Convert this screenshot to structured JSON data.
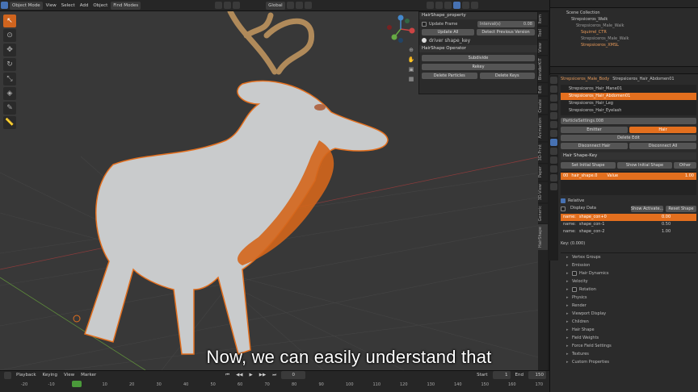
{
  "header": {
    "mode": "Object Mode",
    "menus": [
      "View",
      "Select",
      "Add",
      "Object"
    ],
    "find_modes": "Find Modes",
    "transform": "Global"
  },
  "hair_panel": {
    "title": "HairShape_property",
    "update_frame": "Update Frame",
    "interval_label": "Interval(s)",
    "interval_value": "0.08",
    "update_all": "Update All",
    "detect_prev": "Detect Previous Version",
    "driver_key": "driver shape_key",
    "operator_title": "HairShape Operator",
    "subdivide": "Subdivide",
    "rekey": "Rekey",
    "delete_particles": "Delete Particles",
    "delete_keys": "Delete Keys"
  },
  "vtabs": [
    "Item",
    "Tool",
    "View",
    "BlenderKIT",
    "Edit",
    "Create",
    "Animation",
    "3D-Print",
    "Paper",
    "3D-View",
    "Generic",
    "HairShape"
  ],
  "outliner": {
    "title": "Scene Collection",
    "items": [
      "Strepsiceros_Walk",
      "Strepsiceros_Male_Walk",
      "Squirrel_CTR",
      "Strepsiceros_Male_Walk",
      "Strepsiceros_XMSL"
    ]
  },
  "properties": {
    "obj_name": "Strepsiceros_Male_Body",
    "psys_name": "Strepsiceros_Hair_Abdomen01",
    "psys_list": [
      "Strepsiceros_Hair_Mane01",
      "Strepsiceros_Hair_Abdomen01",
      "Strepsiceros_Hair_Leg",
      "Strepsiceros_Hair_Eyelash"
    ],
    "settings": "ParticleSettings.008",
    "emitter": "Emitter",
    "hair": "Hair",
    "delete_edit": "Delete Edit",
    "disconnect_hair": "Disconnect Hair",
    "disconnect_all": "Disconnect All",
    "shape_key_title": "Hair Shape-Key",
    "set_initial": "Set Initial Shape",
    "show_initial": "Show Initial Shape",
    "other": "Other",
    "active_key_index": "00",
    "active_key_name": "hair_shape.0",
    "value_label": "Value",
    "value": "1.00",
    "relative": "Relative",
    "display_data": "Display Data",
    "show_activate": "Show Activate...",
    "reset_shape": "Reset Shape",
    "name_label": "name:",
    "shapes": [
      {
        "name": "shape_con+0",
        "value": "0.00"
      },
      {
        "name": "shape_con-1",
        "value": "0.50"
      },
      {
        "name": "shape_con-2",
        "value": "1.00"
      }
    ],
    "key_label": "Key: (0.000)",
    "sections": [
      "Vertex Groups",
      "Emission",
      "Hair Dynamics",
      "Velocity",
      "Rotation",
      "Physics",
      "Render",
      "Viewport Display",
      "Children",
      "Hair Shape",
      "Field Weights",
      "Force Field Settings",
      "Textures",
      "Custom Properties"
    ]
  },
  "timeline": {
    "playback": "Playback",
    "keying": "Keying",
    "view": "View",
    "marker": "Marker",
    "current_frame": "0",
    "start_label": "Start",
    "start": "1",
    "end_label": "End",
    "end": "150",
    "ticks": [
      "-20",
      "-10",
      "0",
      "10",
      "20",
      "30",
      "40",
      "50",
      "60",
      "70",
      "80",
      "90",
      "100",
      "110",
      "120",
      "130",
      "140",
      "150",
      "160",
      "170"
    ]
  },
  "subtitle": "Now, we can easily understand that",
  "colors": {
    "accent": "#e36f1e",
    "blue": "#4772b3",
    "bg": "#383838"
  }
}
